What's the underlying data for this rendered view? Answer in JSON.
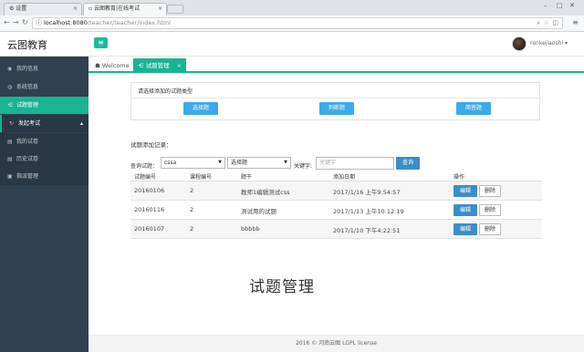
{
  "browser": {
    "tabs": [
      {
        "label": "设置",
        "close": "×"
      },
      {
        "label": "云图教育|在线考试",
        "close": "×"
      }
    ],
    "url_host": "localhost:8080",
    "url_path": "/teacher/teacher/index.html"
  },
  "header": {
    "brand": "云图教育",
    "username": "renkejiaoshi"
  },
  "sidebar": {
    "items": [
      {
        "icon": "user-icon",
        "label": "我的信息"
      },
      {
        "icon": "users-icon",
        "label": "系统信息"
      },
      {
        "icon": "share-icon",
        "label": "试题管理"
      },
      {
        "icon": "refresh-icon",
        "label": "发起考试"
      },
      {
        "icon": "list-icon",
        "label": "我的试卷"
      },
      {
        "icon": "list-icon",
        "label": "历史试卷"
      },
      {
        "icon": "file-icon",
        "label": "指派管理"
      }
    ]
  },
  "page_tabs": [
    {
      "label": "Welcome"
    },
    {
      "label": "试题管理",
      "close": "×"
    }
  ],
  "qtype": {
    "title": "请选择添加的试题类型",
    "buttons": [
      "选择题",
      "判断题",
      "简答题"
    ]
  },
  "records": {
    "title": "试题添加记录：",
    "filter_label": "查询试题：",
    "course_select": "cssa",
    "type_select": "选择题",
    "keyword_label": "关键字:",
    "keyword_placeholder": "关键字",
    "search_button": "查询",
    "columns": [
      "试题编号",
      "课程编号",
      "题干",
      "添加日期",
      "操作"
    ],
    "rows": [
      {
        "id": "20160106",
        "course": "2",
        "stem": "教师1编辑测试css",
        "date": "2017/1/16 上午9:54:57",
        "edit": "编辑",
        "delete": "删除"
      },
      {
        "id": "20160116",
        "course": "2",
        "stem": "测试用的试题",
        "date": "2017/1/13 上午10:12:19",
        "edit": "编辑",
        "delete": "删除"
      },
      {
        "id": "20160107",
        "course": "2",
        "stem": "bbbbb",
        "date": "2017/1/10 下午4:22:51",
        "edit": "编辑",
        "delete": "删除"
      }
    ]
  },
  "page_title": "试题管理",
  "footer": "2016 © 河南云图 LGPL license",
  "colors": {
    "accent": "#1ab394",
    "sidebar": "#2f4050",
    "primary": "#3c8dc6",
    "qtype_button": "#3ca9e8"
  }
}
